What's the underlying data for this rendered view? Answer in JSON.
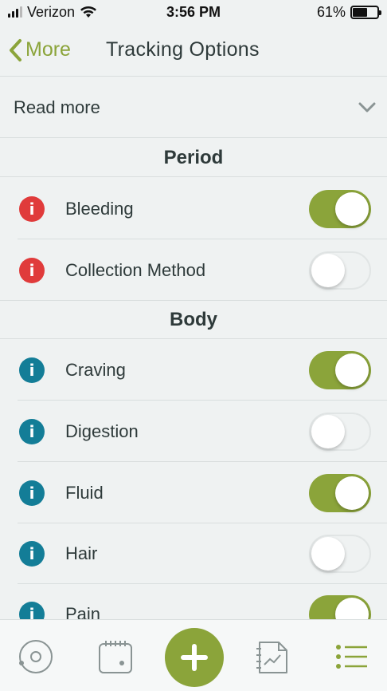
{
  "status_bar": {
    "carrier": "Verizon",
    "time": "3:56 PM",
    "battery": "61%",
    "battery_level": 0.61
  },
  "nav": {
    "back_label": "More",
    "title": "Tracking Options"
  },
  "read_more": {
    "label": "Read more"
  },
  "sections": [
    {
      "title": "Period",
      "items": [
        {
          "label": "Bleeding",
          "enabled": true,
          "info_color": "#e03b3b"
        },
        {
          "label": "Collection Method",
          "enabled": false,
          "info_color": "#e03b3b"
        }
      ]
    },
    {
      "title": "Body",
      "items": [
        {
          "label": "Craving",
          "enabled": true,
          "info_color": "#137d97"
        },
        {
          "label": "Digestion",
          "enabled": false,
          "info_color": "#137d97"
        },
        {
          "label": "Fluid",
          "enabled": true,
          "info_color": "#137d97"
        },
        {
          "label": "Hair",
          "enabled": false,
          "info_color": "#137d97"
        },
        {
          "label": "Pain",
          "enabled": true,
          "info_color": "#137d97"
        }
      ]
    }
  ],
  "tab_bar": {
    "tabs": [
      "cycle-icon",
      "calendar-icon",
      "add-icon",
      "analysis-icon",
      "settings-list-icon"
    ],
    "accent_color": "#8ba43a"
  }
}
